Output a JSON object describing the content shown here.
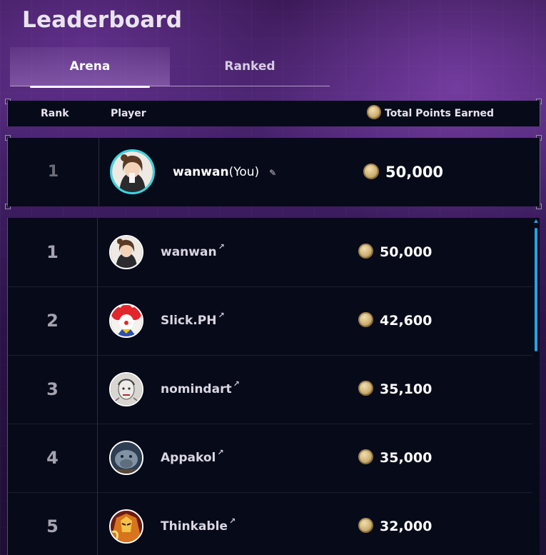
{
  "page": {
    "title": "Leaderboard"
  },
  "tabs": [
    {
      "label": "Arena",
      "active": true
    },
    {
      "label": "Ranked",
      "active": false
    }
  ],
  "table_header": {
    "rank": "Rank",
    "player": "Player",
    "points": "Total Points Earned"
  },
  "current_user": {
    "rank": "1",
    "name": "wanwan",
    "you_suffix": "(You)",
    "points": "50,000",
    "edit_icon": "pencil-icon"
  },
  "rows": [
    {
      "rank": "1",
      "name": "wanwan",
      "points": "50,000",
      "avatar": "avatar-anime-girl"
    },
    {
      "rank": "2",
      "name": "Slick.PH",
      "points": "42,600",
      "avatar": "avatar-clown"
    },
    {
      "rank": "3",
      "name": "nomindart",
      "points": "35,100",
      "avatar": "avatar-sketch"
    },
    {
      "rank": "4",
      "name": "Appakol",
      "points": "35,000",
      "avatar": "avatar-creature"
    },
    {
      "rank": "5",
      "name": "Thinkable",
      "points": "32,000",
      "avatar": "avatar-hero"
    }
  ],
  "icons": {
    "coin": "coin-icon",
    "external": "external-link-icon"
  },
  "colors": {
    "accent": "#1da4ea",
    "panel": "#070a19",
    "coin": "#d2b67a"
  }
}
